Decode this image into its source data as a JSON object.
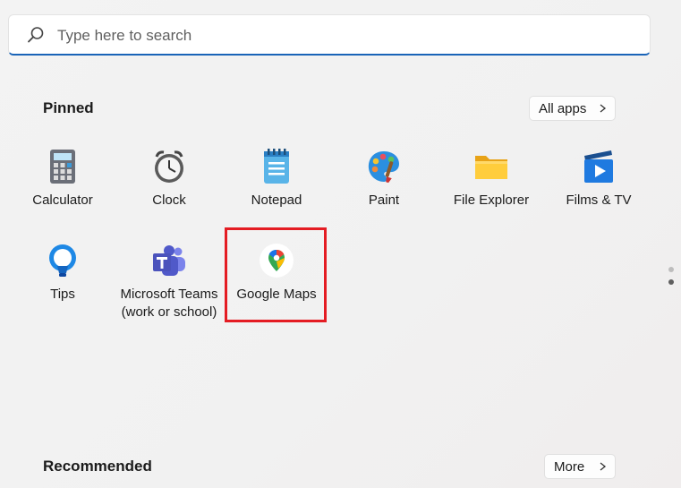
{
  "search": {
    "placeholder": "Type here to search"
  },
  "pinned": {
    "title": "Pinned",
    "all_apps_label": "All apps",
    "apps": [
      {
        "label": "Calculator",
        "icon": "calculator-icon"
      },
      {
        "label": "Clock",
        "icon": "clock-icon"
      },
      {
        "label": "Notepad",
        "icon": "notepad-icon"
      },
      {
        "label": "Paint",
        "icon": "paint-icon"
      },
      {
        "label": "File Explorer",
        "icon": "folder-icon"
      },
      {
        "label": "Films & TV",
        "icon": "films-tv-icon"
      },
      {
        "label": "Tips",
        "icon": "tips-icon"
      },
      {
        "label": "Microsoft Teams\n(work or school)",
        "icon": "teams-icon"
      },
      {
        "label": "Google Maps",
        "icon": "google-maps-icon"
      }
    ]
  },
  "recommended": {
    "title": "Recommended",
    "more_label": "More"
  },
  "colors": {
    "accent": "#1a64b8",
    "highlight": "#e41c23"
  }
}
